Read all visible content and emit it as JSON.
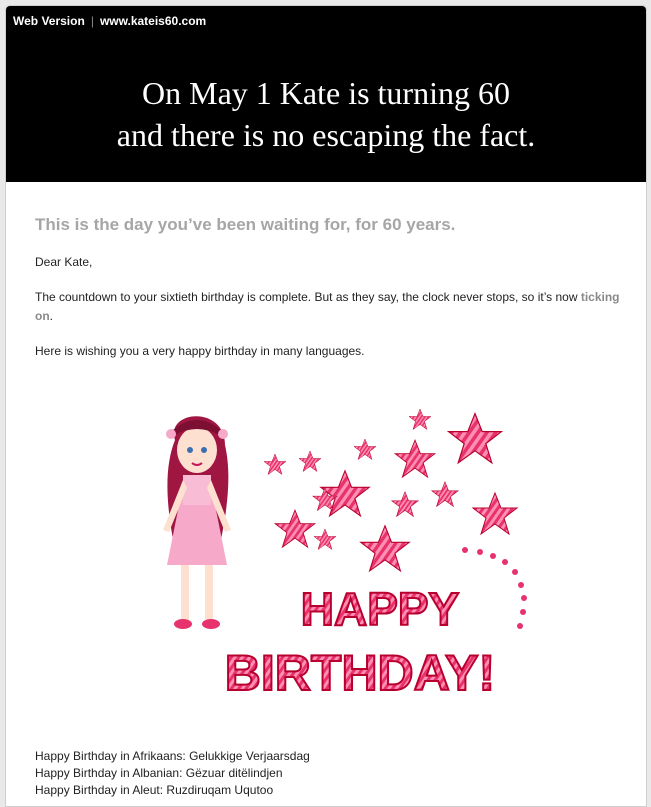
{
  "header": {
    "web_version": "Web Version",
    "separator": "|",
    "site": "www.kateis60.com",
    "headline_line1": "On May 1 Kate is turning 60",
    "headline_line2": "and there is no escaping the fact."
  },
  "body": {
    "lead": "This is the day you’ve been waiting for, for 60 years.",
    "greeting": "Dear Kate,",
    "para1_text": "The countdown to your sixtieth birthday is complete. But as they say, the clock never stops, so it’s now ",
    "para1_link": "ticking on",
    "para1_end": ".",
    "para2": "Here is wishing you a very happy birthday in many languages."
  },
  "graphic": {
    "word1": "HAPPY",
    "word2": "BIRTHDAY!",
    "colors": {
      "star": "#e8326d",
      "text": "#e8326d",
      "outline": "#b8002e",
      "dress": "#f6a9c9",
      "hair": "#a01642"
    },
    "icons": [
      "girl-illustration",
      "star-icon"
    ]
  },
  "languages": [
    "Happy Birthday in Afrikaans: Gelukkige Verjaarsdag",
    "Happy Birthday in Albanian: Gëzuar ditëlindjen",
    "Happy Birthday in Aleut: Ruzdiruqam Uqutoo"
  ]
}
